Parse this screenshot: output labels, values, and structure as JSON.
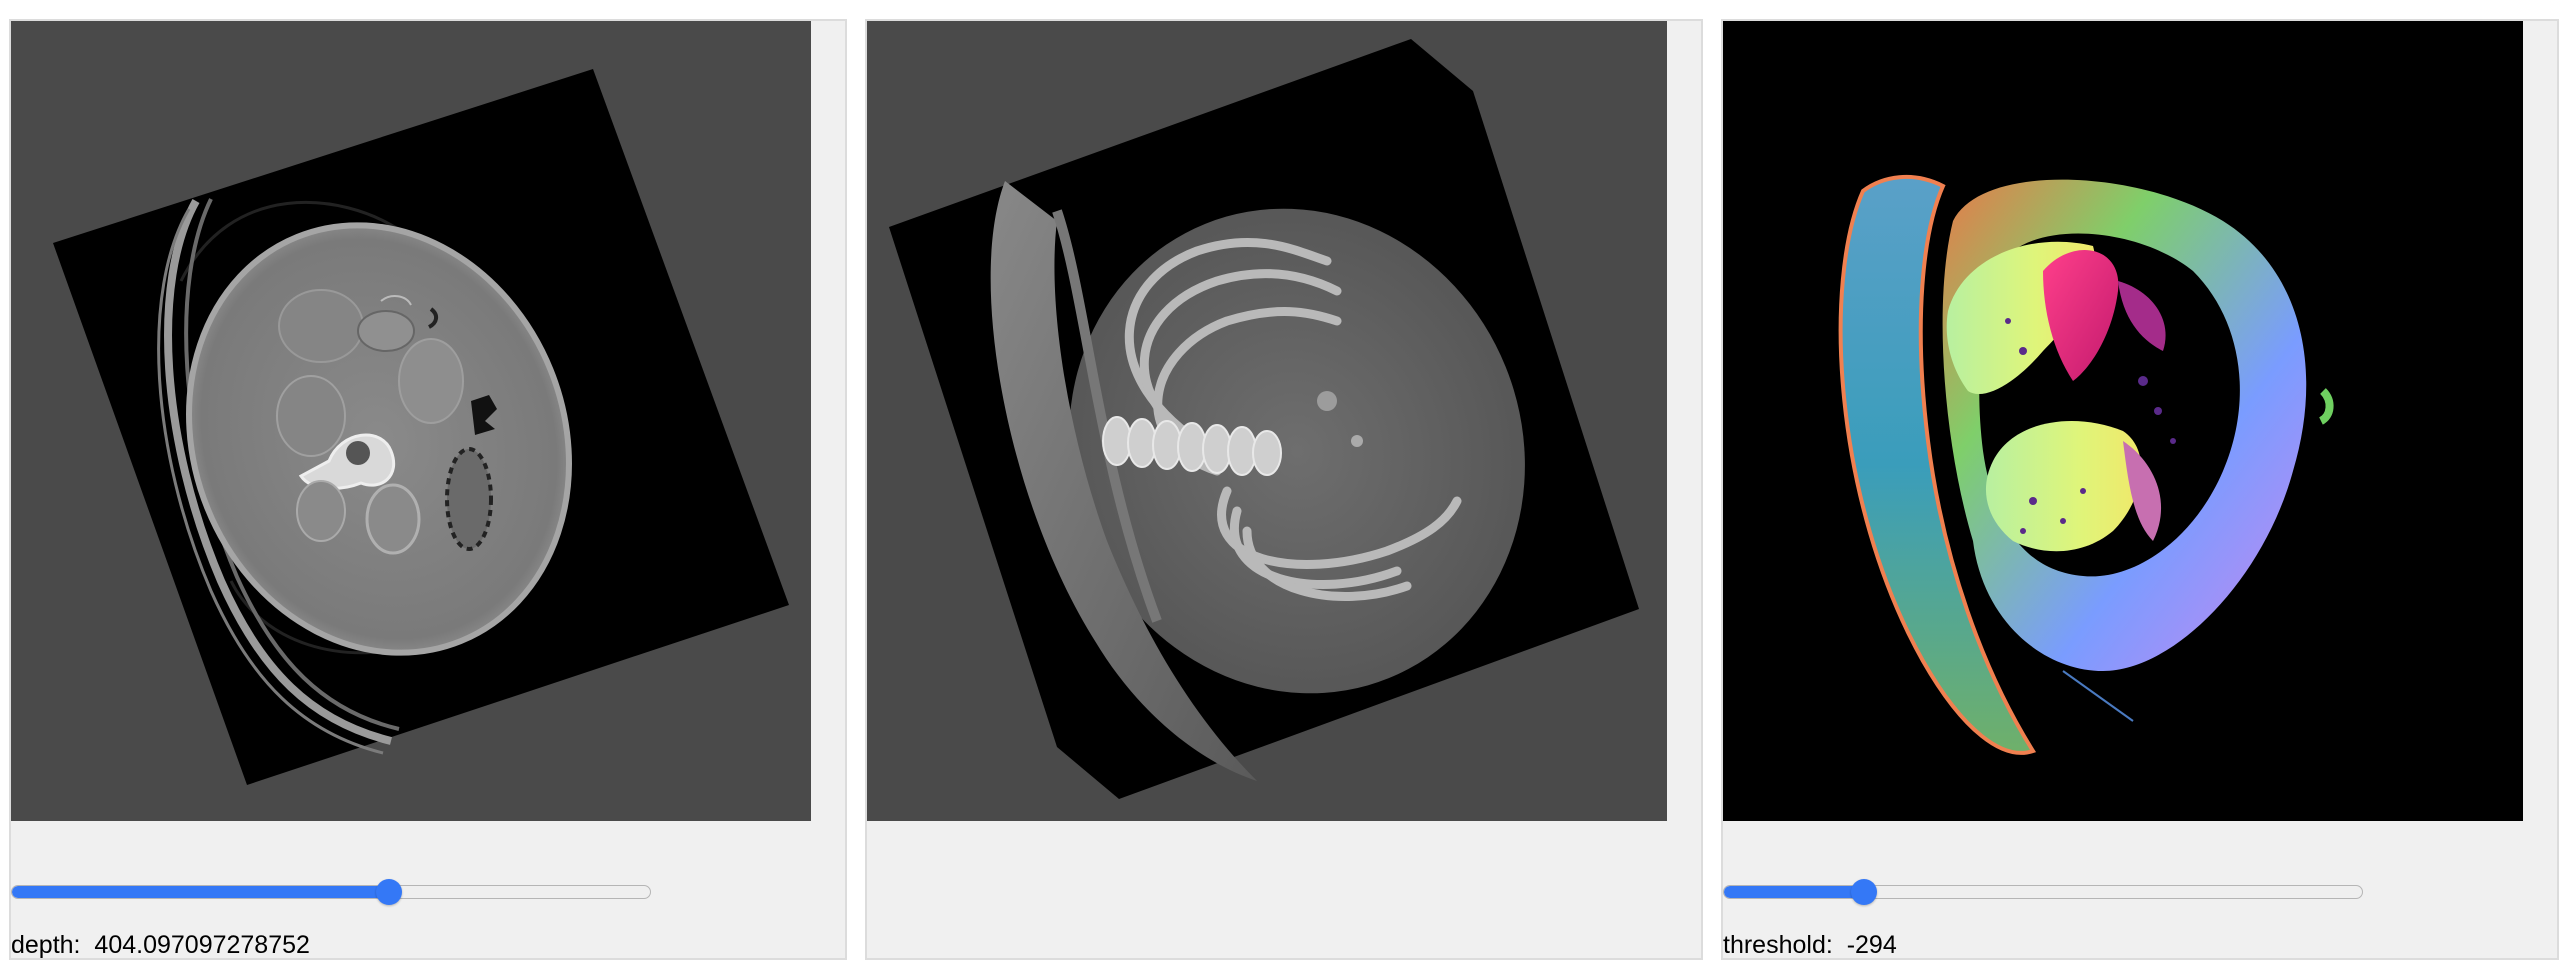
{
  "panels": [
    {
      "view": "2D slice",
      "background_color": "#4a4a4a",
      "slider": {
        "name": "depth",
        "value": 404.097097278752,
        "fraction": 0.59
      },
      "readout": {
        "label": "depth:",
        "value": "404.097097278752"
      }
    },
    {
      "view": "volume rendering",
      "background_color": "#4a4a4a"
    },
    {
      "view": "isosurface",
      "background_color": "#000000",
      "slider": {
        "name": "threshold",
        "value": -294,
        "fraction": 0.22
      },
      "readout": {
        "label": "threshold:",
        "value": "-294"
      }
    }
  ],
  "colors": {
    "slider_accent": "#3478f6",
    "panel_background": "#f0f0f0"
  }
}
